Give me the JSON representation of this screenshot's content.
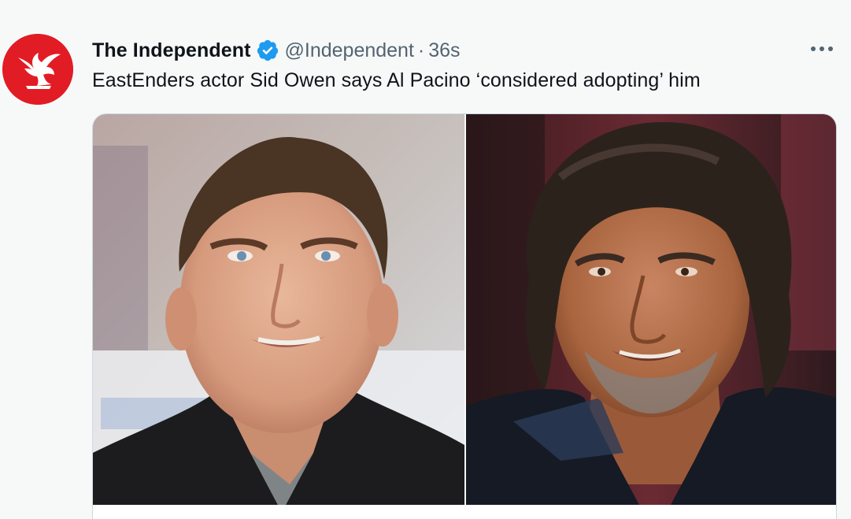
{
  "tweet": {
    "author": {
      "display_name": "The Independent",
      "handle": "@Independent",
      "verified": true,
      "avatar_icon": "eagle-logo-icon",
      "avatar_color": "#e21c24"
    },
    "separator": "·",
    "timestamp": "36s",
    "text": "EastEnders actor Sid Owen says Al Pacino ‘considered adopting’ him",
    "more_icon": "more-options-icon",
    "media": [
      {
        "alt": "Sid Owen portrait",
        "icon": "photo-sid-owen"
      },
      {
        "alt": "Al Pacino portrait",
        "icon": "photo-al-pacino"
      }
    ]
  },
  "colors": {
    "background": "#f7f9f9",
    "text_primary": "#0f1419",
    "text_secondary": "#536471",
    "verified_blue": "#1d9bf0",
    "card_border": "#cfd9de"
  }
}
